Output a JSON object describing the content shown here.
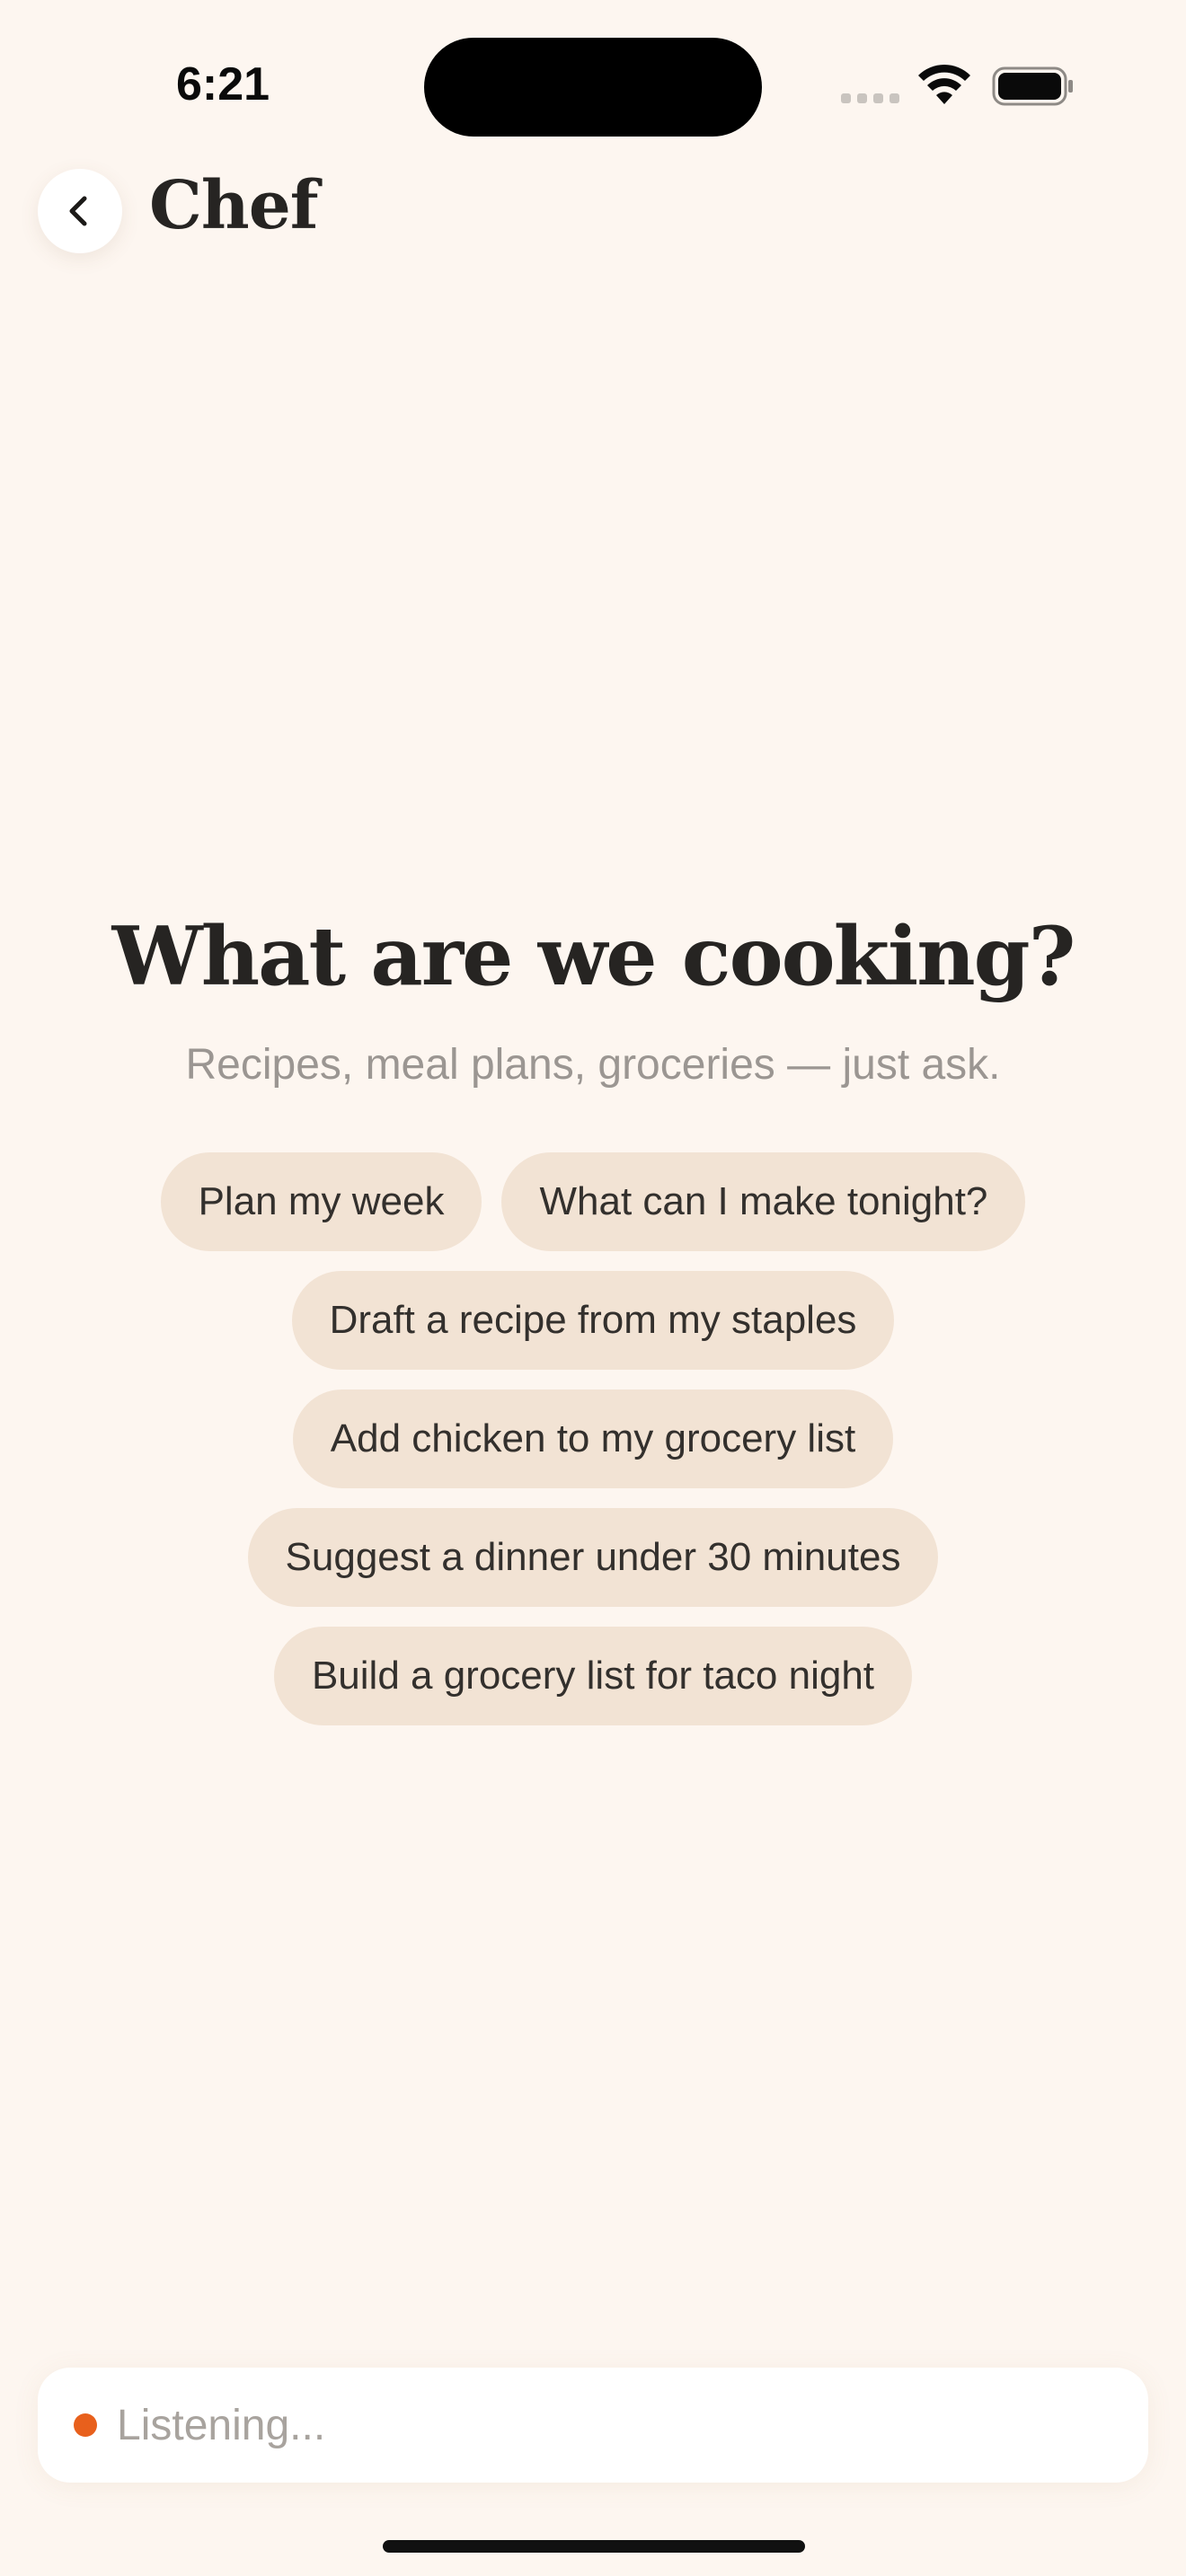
{
  "status_bar": {
    "time": "6:21",
    "icons": [
      "cellular-signal-icon",
      "wifi-icon",
      "battery-icon"
    ]
  },
  "header": {
    "title": "Chef",
    "back_icon": "chevron-left-icon"
  },
  "hero": {
    "title": "What are we cooking?",
    "subtitle": "Recipes, meal plans, groceries — just ask."
  },
  "suggestions": [
    "Plan my week",
    "What can I make tonight?",
    "Draft a recipe from my staples",
    "Add chicken to my grocery list",
    "Suggest a dinner under 30 minutes",
    "Build a grocery list for taco night"
  ],
  "input": {
    "status_text": "Listening...",
    "recording_color": "#E8601C"
  },
  "colors": {
    "background": "#FDF6F0",
    "chip": "#F2E3D4",
    "accent": "#E8601C",
    "text": "#262422"
  }
}
